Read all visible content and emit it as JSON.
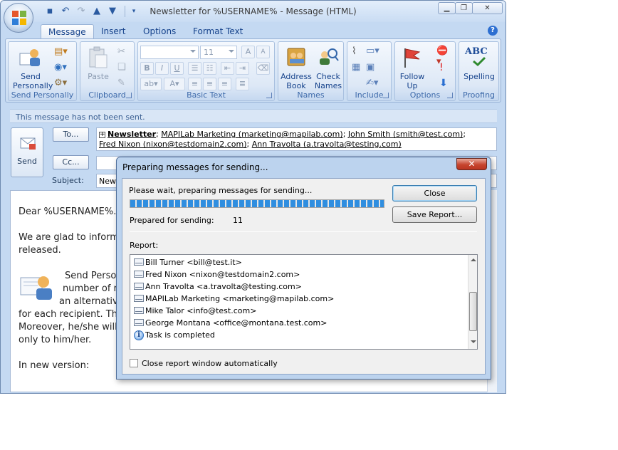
{
  "window": {
    "title": "Newsletter for %USERNAME% - Message (HTML)"
  },
  "ribbon": {
    "tabs": [
      {
        "label": "Message",
        "active": true
      },
      {
        "label": "Insert",
        "active": false
      },
      {
        "label": "Options",
        "active": false
      },
      {
        "label": "Format Text",
        "active": false
      }
    ],
    "groups": {
      "send_personally": {
        "label": "Send Personally",
        "button_line1": "Send",
        "button_line2": "Personally"
      },
      "clipboard": {
        "label": "Clipboard",
        "paste": "Paste"
      },
      "basic_text": {
        "label": "Basic Text",
        "font_size": "11"
      },
      "names": {
        "label": "Names",
        "address_book_1": "Address",
        "address_book_2": "Book",
        "check_names_1": "Check",
        "check_names_2": "Names"
      },
      "include": {
        "label": "Include"
      },
      "options": {
        "label": "Options",
        "follow_up_1": "Follow",
        "follow_up_2": "Up"
      },
      "proofing": {
        "label": "Proofing",
        "spelling": "Spelling",
        "abc": "ABC"
      }
    }
  },
  "infobar": {
    "text": "This message has not been sent."
  },
  "compose": {
    "send_label": "Send",
    "to_label": "To...",
    "cc_label": "Cc...",
    "subject_label": "Subject:",
    "subject_value": "New",
    "to_recipients_line1": [
      {
        "text": "Newsletter",
        "bold": true
      },
      {
        "text": "MAPILab Marketing (marketing@mapilab.com)"
      },
      {
        "text": "John Smith (smith@test.com)"
      }
    ],
    "to_recipients_line2": [
      {
        "text": "Fred Nixon (nixon@testdomain2.com)"
      },
      {
        "text": "Ann Travolta (a.travolta@testing.com)"
      }
    ]
  },
  "body": {
    "greeting": "Dear %USERNAME%.",
    "p1_a": "We are glad to inform y",
    "p1_b": "released.",
    "p2_a": "Send Person",
    "p2_b": "number of re",
    "p2_c": "an alternativ",
    "p2_d": "for each recipient. The",
    "p2_e": "Moreover, he/she will",
    "p2_f": "only to him/her.",
    "p3": "In new version:"
  },
  "dialog": {
    "title": "Preparing messages for sending...",
    "close_x": "✕",
    "wait_text": "Please wait, preparing messages for sending...",
    "progress": 1.0,
    "prepared_label": "Prepared for sending:",
    "prepared_value": "11",
    "close_button": "Close",
    "save_report_button": "Save Report...",
    "report_label": "Report:",
    "report_rows": [
      {
        "icon": "envelope-icon",
        "text": "Bill Turner <bill@test.it>"
      },
      {
        "icon": "envelope-icon",
        "text": "Fred Nixon <nixon@testdomain2.com>"
      },
      {
        "icon": "envelope-icon",
        "text": "Ann Travolta <a.travolta@testing.com>"
      },
      {
        "icon": "envelope-icon",
        "text": "MAPILab Marketing <marketing@mapilab.com>"
      },
      {
        "icon": "envelope-icon",
        "text": "Mike Talor <info@test.com>"
      },
      {
        "icon": "envelope-icon",
        "text": "George Montana <office@montana.test.com>"
      },
      {
        "icon": "info-icon",
        "text": "Task is completed"
      }
    ],
    "auto_close_label": "Close report window automatically",
    "auto_close_checked": false
  }
}
